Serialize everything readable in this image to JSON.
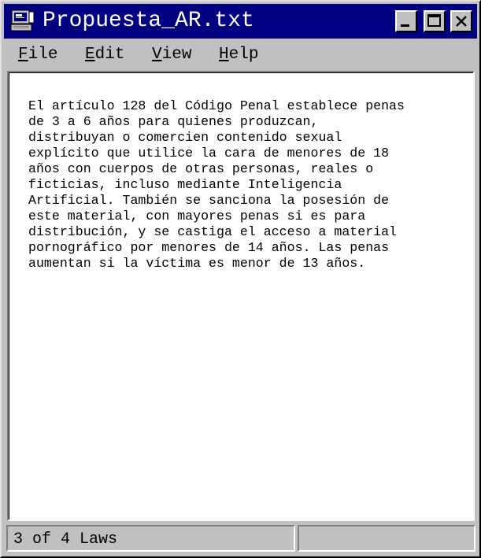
{
  "window": {
    "title": "Propuesta_AR.txt",
    "title_bar_color": "#000080",
    "icon": "computer-notepad-icon"
  },
  "title_buttons": {
    "minimize_icon": "minimize-icon",
    "maximize_icon": "maximize-icon",
    "close_icon": "close-icon"
  },
  "menu": {
    "file": {
      "accel": "F",
      "rest": "ile"
    },
    "edit": {
      "accel": "E",
      "rest": "dit"
    },
    "view": {
      "accel": "V",
      "rest": "iew"
    },
    "help": {
      "accel": "H",
      "rest": "elp"
    }
  },
  "document": {
    "text": "El artículo 128 del Código Penal establece penas\nde 3 a 6 años para quienes produzcan,\ndistribuyan o comercien contenido sexual\nexplícito que utilice la cara de menores de 18\naños con cuerpos de otras personas, reales o\nficticias, incluso mediante Inteligencia\nArtificial. También se sanciona la posesión de\neste material, con mayores penas si es para\ndistribución, y se castiga el acceso a material\npornográfico por menores de 14 años. Las penas\naumentan si la víctima es menor de 13 años."
  },
  "status": {
    "left": "3 of 4 Laws",
    "right": ""
  }
}
